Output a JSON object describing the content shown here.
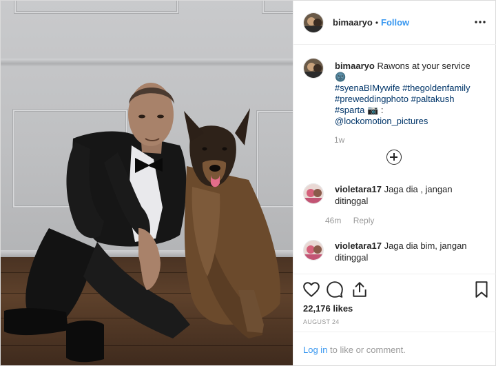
{
  "post": {
    "username": "bimaaryo",
    "separator": "•",
    "follow_label": "Follow",
    "more_label": "•••"
  },
  "caption": {
    "username": "bimaaryo",
    "text": "Rawons at your service",
    "emoji": "🌚",
    "hashtags_line1": "#syenaBIMywife #thegoldenfamily",
    "hashtags_line2": "#preweddingphoto #paltakush",
    "hashtag_sparta": "#sparta",
    "camera_emoji": "📷",
    "colon": ":",
    "mention": "@lockomotion_pictures",
    "time": "1w"
  },
  "comments": [
    {
      "username": "violetara17",
      "text": "Jaga dia , jangan ditinggal",
      "time": "46m",
      "reply_label": "Reply"
    },
    {
      "username": "violetara17",
      "text": "Jaga dia bim, jangan ditinggal"
    }
  ],
  "actions": {
    "likes": "22,176 likes",
    "date": "AUGUST 24"
  },
  "add_comment": {
    "login_label": "Log in",
    "rest_text": " to like or comment."
  },
  "icons": [
    "heart-icon",
    "comment-icon",
    "share-icon",
    "bookmark-icon",
    "more-options-icon",
    "plus-circle-icon"
  ]
}
